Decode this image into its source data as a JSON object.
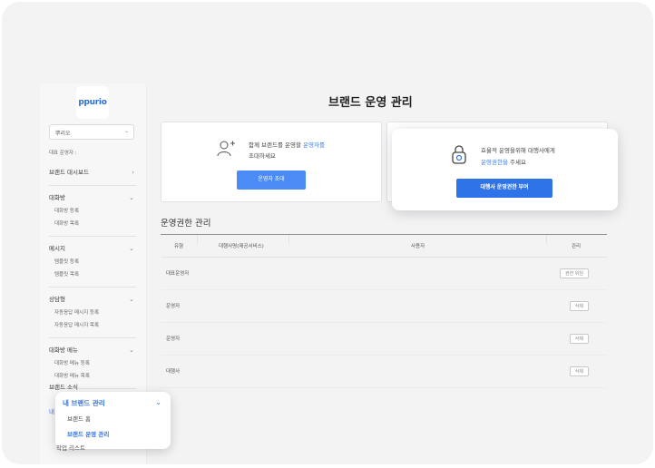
{
  "sidebar": {
    "logo": "ppurio",
    "brand_select": "뿌리오",
    "rep_label": "대표 운영자 :",
    "menus": [
      {
        "label": "브랜드 대시보드",
        "arrow": "›",
        "subs": []
      },
      {
        "label": "대화방",
        "arrow": "⌄",
        "subs": [
          "대화방 등록",
          "대화방 목록"
        ]
      },
      {
        "label": "메시지",
        "arrow": "⌄",
        "subs": [
          "템플릿 등록",
          "템플릿 목록"
        ]
      },
      {
        "label": "상담형",
        "arrow": "⌄",
        "subs": [
          "자동응답 메시지 등록",
          "자동응답 메시지 목록"
        ]
      },
      {
        "label": "대화방 메뉴",
        "arrow": "⌄",
        "subs": [
          "대화방 메뉴 등록",
          "대화방 메뉴 목록"
        ]
      }
    ],
    "brand_news": "브랜드 소식",
    "peek_char": "내"
  },
  "main": {
    "title": "브랜드 운영 관리",
    "invite_card": {
      "msg_prefix": "함께 브랜드를 운영할",
      "msg_accent": "운영자를",
      "msg_line2": "초대하세요",
      "button": "운영자 초대"
    },
    "auth_card": {
      "msg_line1": "효율적 운영을위해 대행사에게",
      "msg_accent": "운영권한을",
      "msg_suffix": "주세요",
      "button": "대행사 운영권한 부여"
    },
    "section_title": "운영권한 관리",
    "table": {
      "headers": [
        "유형",
        "대행사명(제공서비스)",
        "사용자",
        "관리"
      ],
      "rows": [
        {
          "type": "대표운영자",
          "action": "권한 위임"
        },
        {
          "type": "운영자",
          "action": "삭제"
        },
        {
          "type": "운영자",
          "action": "삭제"
        },
        {
          "type": "대행사",
          "action": "삭제"
        }
      ]
    }
  },
  "popup": {
    "head": "내 브랜드 관리",
    "items": [
      "브랜드 홈",
      "브랜드 운영 관리"
    ],
    "peek_below": "작업 리스트"
  },
  "colors": {
    "accent": "#2f73e8",
    "button": "#4a8bf5"
  }
}
